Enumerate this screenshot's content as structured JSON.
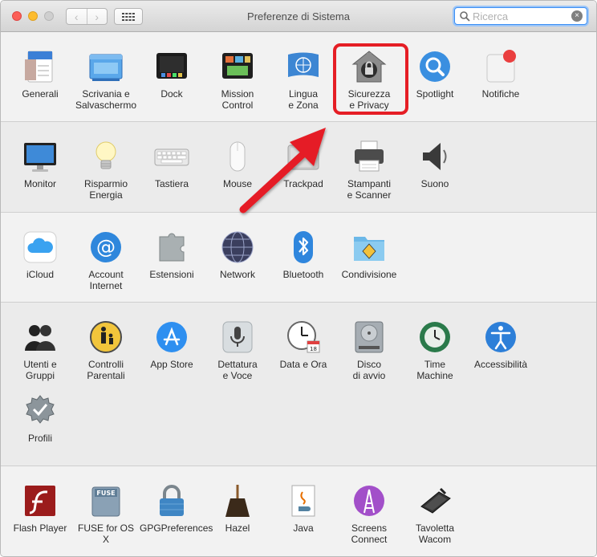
{
  "window": {
    "title": "Preferenze di Sistema"
  },
  "toolbar": {
    "back_glyph": "‹",
    "forward_glyph": "›",
    "grid_icon": "grid-icon"
  },
  "search": {
    "value": "",
    "placeholder": "Ricerca",
    "clear_glyph": "×"
  },
  "colors": {
    "highlight": "#e51e25",
    "accent": "#3c8ff4"
  },
  "sections": [
    {
      "name": "personale",
      "panes": [
        {
          "id": "generali",
          "label": "Generali",
          "icon": "file-icon"
        },
        {
          "id": "scrivania",
          "label": "Scrivania e\nSalvaschermo",
          "icon": "desktop-icon"
        },
        {
          "id": "dock",
          "label": "Dock",
          "icon": "dock-icon"
        },
        {
          "id": "mission",
          "label": "Mission\nControl",
          "icon": "mission-control-icon"
        },
        {
          "id": "lingua",
          "label": "Lingua\ne Zona",
          "icon": "globe-flag-icon"
        },
        {
          "id": "sicurezza",
          "label": "Sicurezza\ne Privacy",
          "icon": "house-lock-icon"
        },
        {
          "id": "spotlight",
          "label": "Spotlight",
          "icon": "magnifier-icon"
        },
        {
          "id": "notifiche",
          "label": "Notifiche",
          "icon": "notification-icon"
        }
      ]
    },
    {
      "name": "hardware",
      "panes": [
        {
          "id": "monitor",
          "label": "Monitor",
          "icon": "monitor-icon"
        },
        {
          "id": "risparmio",
          "label": "Risparmio\nEnergia",
          "icon": "lightbulb-icon"
        },
        {
          "id": "tastiera",
          "label": "Tastiera",
          "icon": "keyboard-icon"
        },
        {
          "id": "mouse",
          "label": "Mouse",
          "icon": "mouse-icon"
        },
        {
          "id": "trackpad",
          "label": "Trackpad",
          "icon": "trackpad-icon"
        },
        {
          "id": "stampanti",
          "label": "Stampanti\ne Scanner",
          "icon": "printer-icon"
        },
        {
          "id": "suono",
          "label": "Suono",
          "icon": "speaker-icon"
        }
      ]
    },
    {
      "name": "internet",
      "panes": [
        {
          "id": "icloud",
          "label": "iCloud",
          "icon": "cloud-icon"
        },
        {
          "id": "account",
          "label": "Account\nInternet",
          "icon": "at-icon"
        },
        {
          "id": "estensioni",
          "label": "Estensioni",
          "icon": "puzzle-icon"
        },
        {
          "id": "network",
          "label": "Network",
          "icon": "network-globe-icon"
        },
        {
          "id": "bluetooth",
          "label": "Bluetooth",
          "icon": "bluetooth-icon"
        },
        {
          "id": "condivisione",
          "label": "Condivisione",
          "icon": "shared-folder-icon"
        }
      ]
    },
    {
      "name": "sistema",
      "panes": [
        {
          "id": "utenti",
          "label": "Utenti e\nGruppi",
          "icon": "users-icon"
        },
        {
          "id": "controlli",
          "label": "Controlli\nParentali",
          "icon": "parental-icon"
        },
        {
          "id": "appstore",
          "label": "App Store",
          "icon": "app-store-icon"
        },
        {
          "id": "dettatura",
          "label": "Dettatura\ne Voce",
          "icon": "microphone-icon"
        },
        {
          "id": "dataora",
          "label": "Data e Ora",
          "icon": "clock-calendar-icon"
        },
        {
          "id": "disco",
          "label": "Disco\ndi avvio",
          "icon": "hard-drive-icon"
        },
        {
          "id": "timemachine",
          "label": "Time\nMachine",
          "icon": "time-machine-icon"
        },
        {
          "id": "accessibilita",
          "label": "Accessibilità",
          "icon": "accessibility-icon"
        },
        {
          "id": "profili",
          "label": "Profili",
          "icon": "badge-check-icon"
        }
      ]
    },
    {
      "name": "altro",
      "panes": [
        {
          "id": "flash",
          "label": "Flash Player",
          "icon": "flash-icon"
        },
        {
          "id": "fuse",
          "label": "FUSE for OS X",
          "icon": "fuse-drive-icon"
        },
        {
          "id": "gpg",
          "label": "GPGPreferences",
          "icon": "padlock-icon"
        },
        {
          "id": "hazel",
          "label": "Hazel",
          "icon": "broom-icon"
        },
        {
          "id": "java",
          "label": "Java",
          "icon": "java-icon"
        },
        {
          "id": "screens",
          "label": "Screens\nConnect",
          "icon": "tower-icon"
        },
        {
          "id": "wacom",
          "label": "Tavoletta Wacom",
          "icon": "tablet-icon"
        }
      ]
    }
  ]
}
